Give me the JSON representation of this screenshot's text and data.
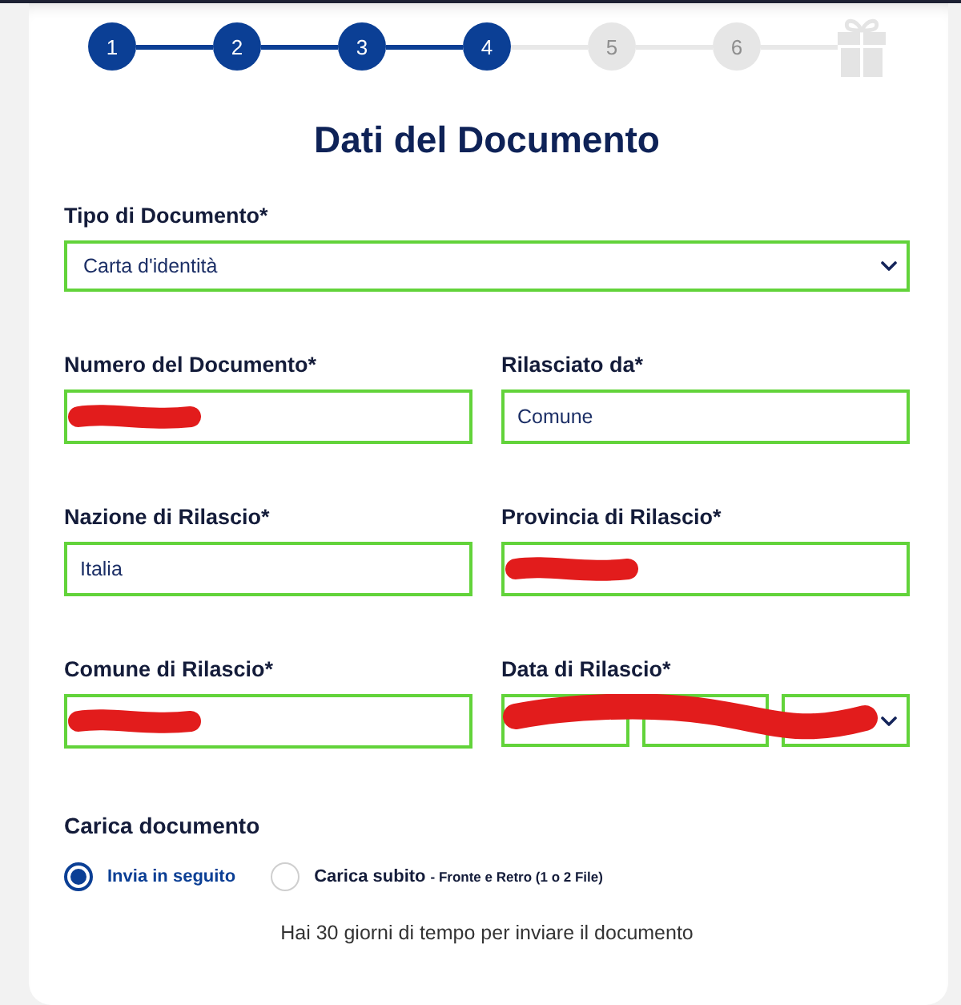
{
  "stepper": {
    "steps": [
      {
        "label": "1",
        "active": true
      },
      {
        "label": "2",
        "active": true
      },
      {
        "label": "3",
        "active": true
      },
      {
        "label": "4",
        "active": true
      },
      {
        "label": "5",
        "active": false
      },
      {
        "label": "6",
        "active": false
      }
    ],
    "final_step": {
      "active": false
    }
  },
  "title": "Dati del Documento",
  "rows": [
    [
      {
        "kind": "select",
        "label": "Tipo di Documento*",
        "value": "Carta d'identità",
        "valid": true,
        "redacted": false
      }
    ],
    [
      {
        "kind": "text",
        "label": "Numero del Documento*",
        "valid": true,
        "redacted": true
      },
      {
        "kind": "text",
        "label": "Rilasciato da*",
        "value": "Comune",
        "valid": true,
        "redacted": false
      }
    ],
    [
      {
        "kind": "text",
        "label": "Nazione di Rilascio*",
        "value": "Italia",
        "valid": true,
        "redacted": false
      },
      {
        "kind": "text",
        "label": "Provincia di Rilascio*",
        "valid": true,
        "redacted": true
      }
    ],
    [
      {
        "kind": "text",
        "label": "Comune di Rilascio*",
        "valid": true,
        "redacted": true
      },
      {
        "kind": "date",
        "label": "Data di Rilascio*",
        "valid": true,
        "redacted": true,
        "parts": [
          {
            "chevron": false
          },
          {
            "chevron": false
          },
          {
            "chevron": true
          }
        ]
      }
    ]
  ],
  "upload": {
    "title": "Carica documento",
    "options": [
      {
        "label": "Invia in seguito",
        "selected": true
      },
      {
        "label": "Carica subito",
        "hint": "- Fronte e Retro (1 o 2 File)",
        "selected": false
      }
    ],
    "note": "Hai 30 giorni di tempo per inviare il documento"
  }
}
